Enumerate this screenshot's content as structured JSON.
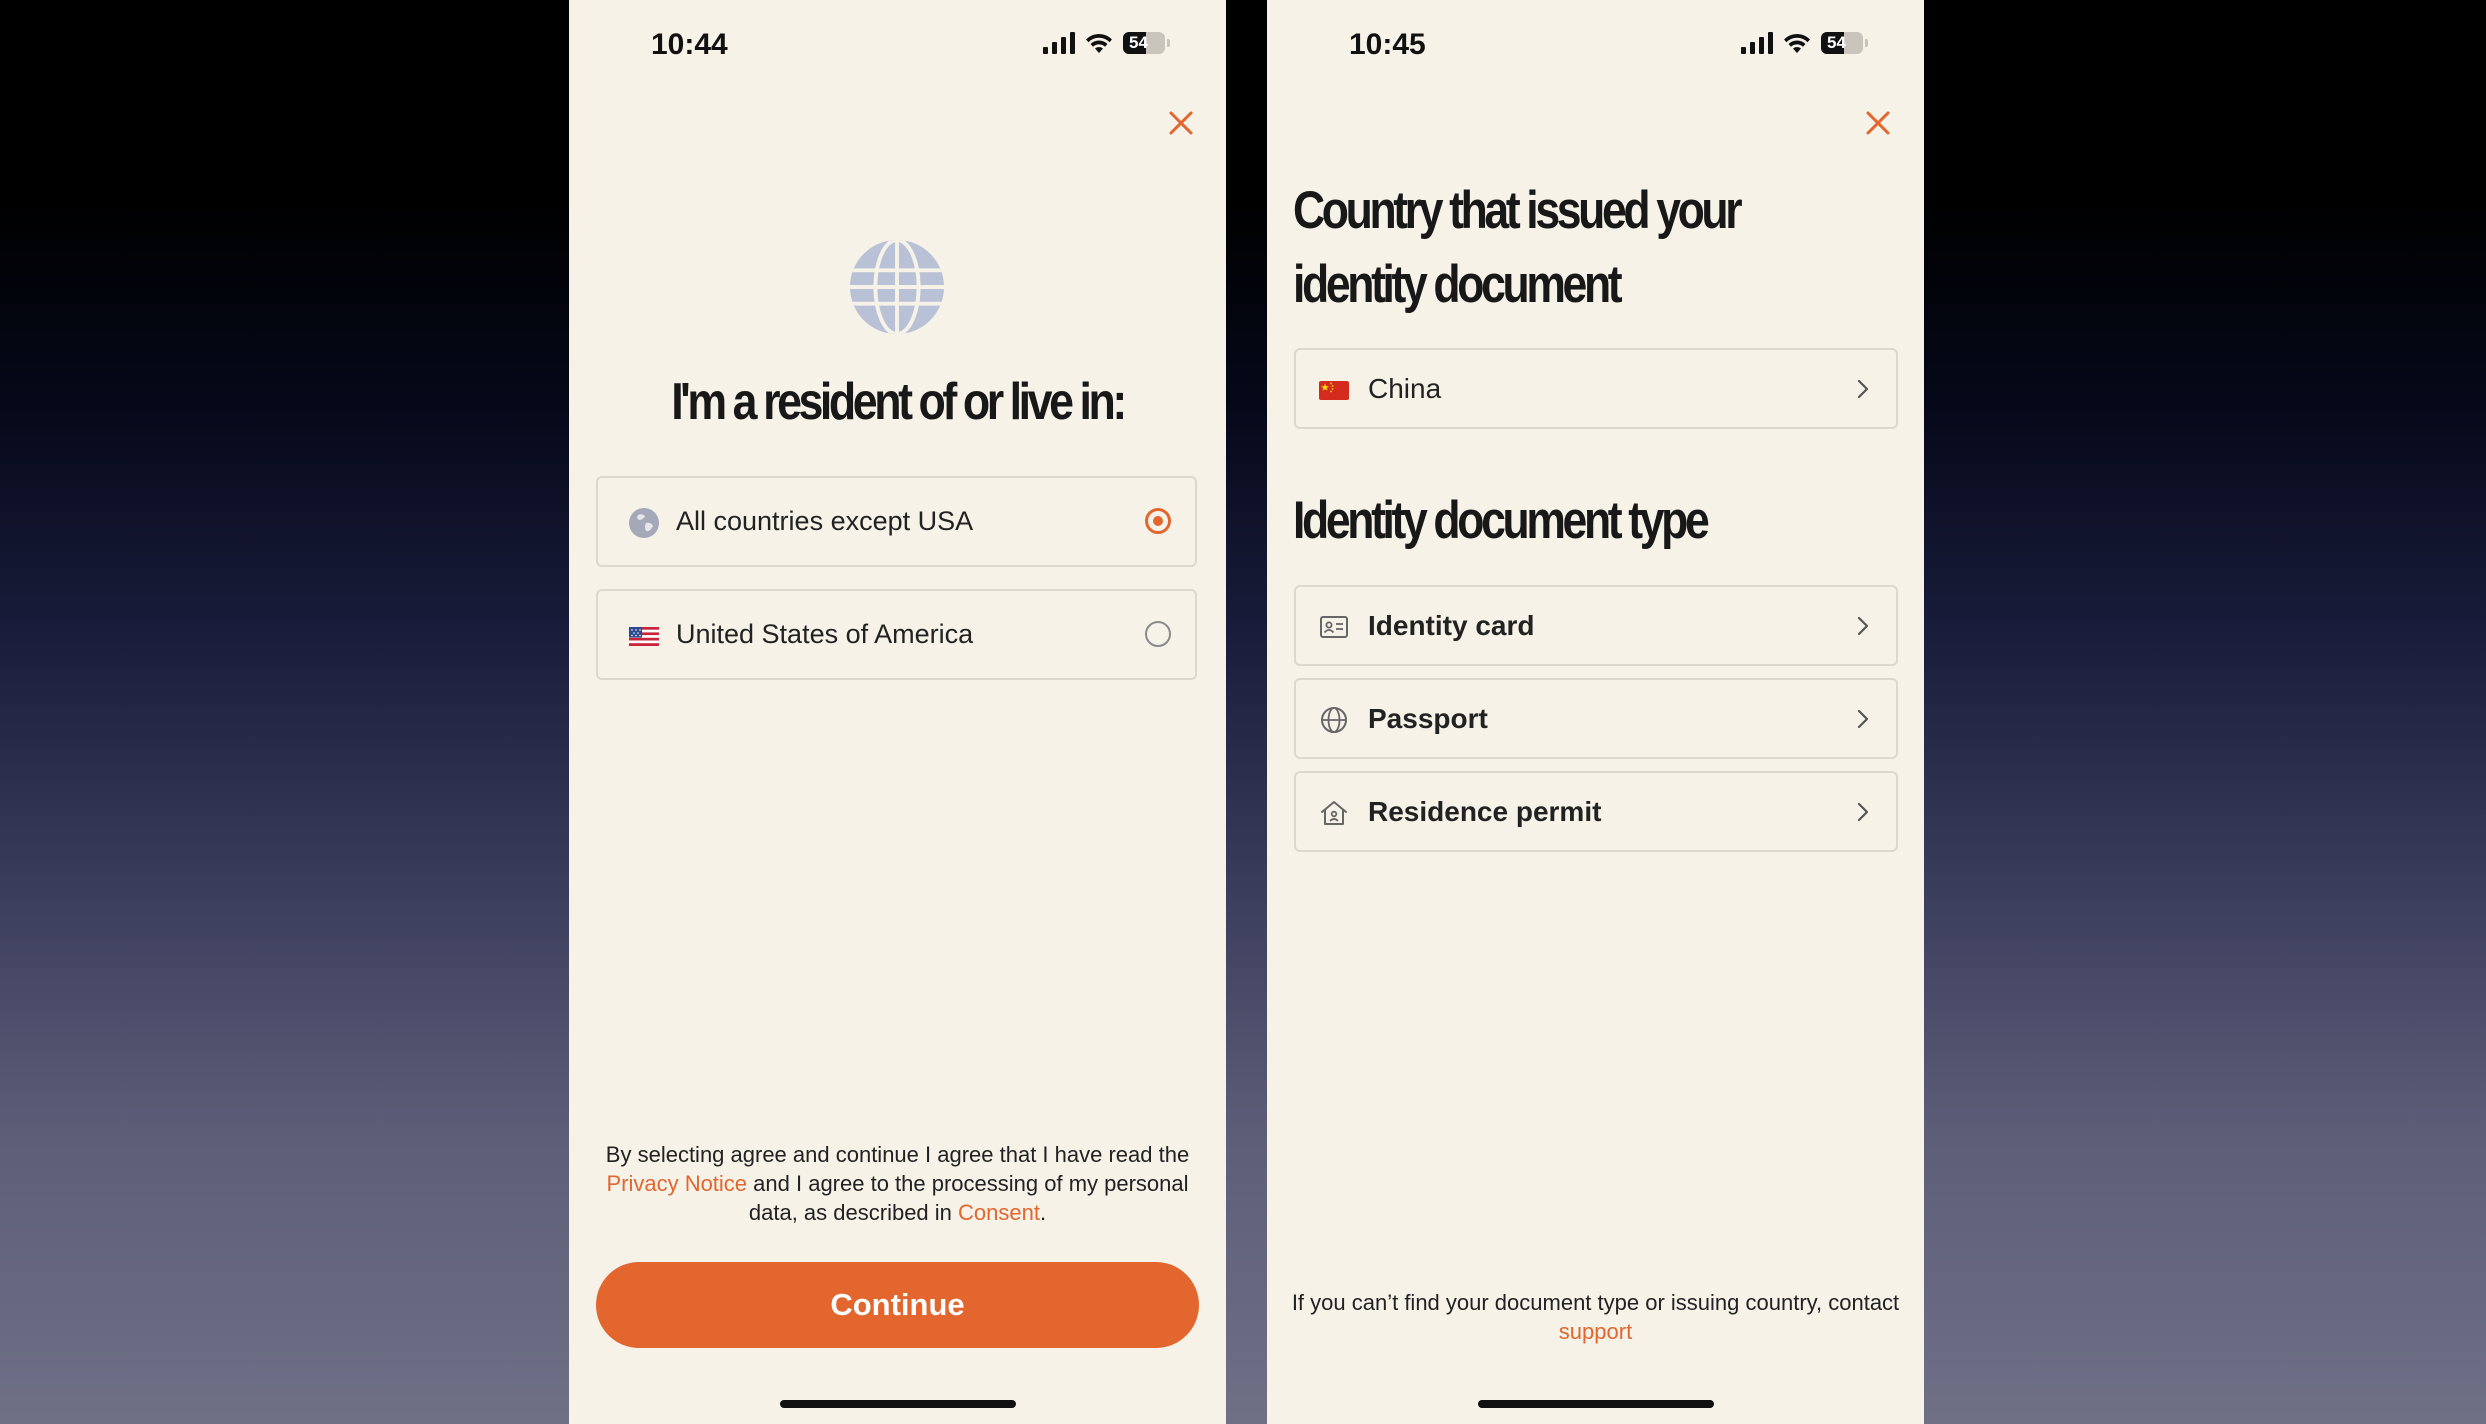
{
  "left_screen": {
    "status": {
      "time": "10:44",
      "battery": "54"
    },
    "heading": "I'm a resident of or live in:",
    "options": [
      {
        "label": "All countries except USA",
        "icon": "globe-icon",
        "selected": true
      },
      {
        "label": "United States of America",
        "icon": "us-flag-icon",
        "selected": false
      }
    ],
    "consent": {
      "part1": "By selecting agree and continue I agree that I have read the ",
      "privacy_link": "Privacy Notice",
      "part2": " and I agree to the processing of my personal data, as described in ",
      "consent_link": "Consent",
      "part3": "."
    },
    "continue_label": "Continue"
  },
  "right_screen": {
    "status": {
      "time": "10:45",
      "battery": "54"
    },
    "country_heading": "Country that issued your identity document",
    "country": {
      "label": "China",
      "icon": "china-flag-icon"
    },
    "doc_heading": "Identity document type",
    "doc_types": [
      {
        "label": "Identity card",
        "icon": "id-card-icon"
      },
      {
        "label": "Passport",
        "icon": "globe-outline-icon"
      },
      {
        "label": "Residence permit",
        "icon": "house-icon"
      }
    ],
    "support_note": {
      "text": "If you can’t find your document type or issuing country, contact ",
      "link": "support"
    }
  },
  "colors": {
    "accent": "#e2662e",
    "panel_bg": "#f6f2e8",
    "border": "#dcd8cf",
    "text": "#222222"
  }
}
